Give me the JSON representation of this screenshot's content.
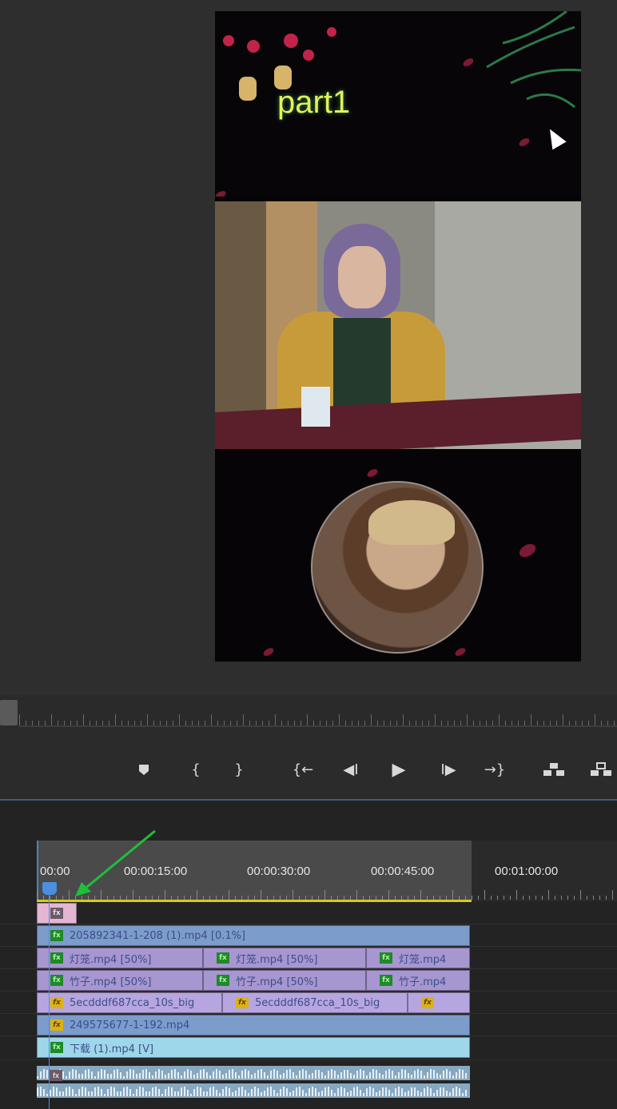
{
  "preview": {
    "title_text": "part1"
  },
  "transport": {
    "marker_icon": "marker-icon",
    "mark_in_label": "{",
    "mark_out_label": "}",
    "go_to_in_label": "{←",
    "step_back_label": "◀I",
    "play_label": "▶",
    "step_forward_label": "I▶",
    "go_to_out_label": "→}",
    "lift_icon": "lift-icon",
    "extract_icon": "extract-icon"
  },
  "timeline": {
    "timecodes": [
      "00:00",
      "00:00:15:00",
      "00:00:30:00",
      "00:00:45:00",
      "00:01:00:00"
    ],
    "clips": {
      "c1": "205892341-1-208 (1).mp4 [0.1%]",
      "c2a": "灯笼.mp4 [50%]",
      "c2b": "灯笼.mp4 [50%]",
      "c2c": "灯笼.mp4",
      "c3a": "竹子.mp4 [50%]",
      "c3b": "竹子.mp4 [50%]",
      "c3c": "竹子.mp4",
      "c4a": "5ecdddf687cca_10s_big",
      "c4b": "5ecdddf687cca_10s_big",
      "c5": "249575677-1-192.mp4",
      "c6": "下载 (1).mp4 [V]"
    },
    "badges": {
      "fx": "fx",
      "green": "fx"
    }
  },
  "colors": {
    "accent_blue": "#4a8fe0",
    "work_area_yellow": "#d9c81e",
    "annotation_arrow": "#1fbf3a"
  }
}
